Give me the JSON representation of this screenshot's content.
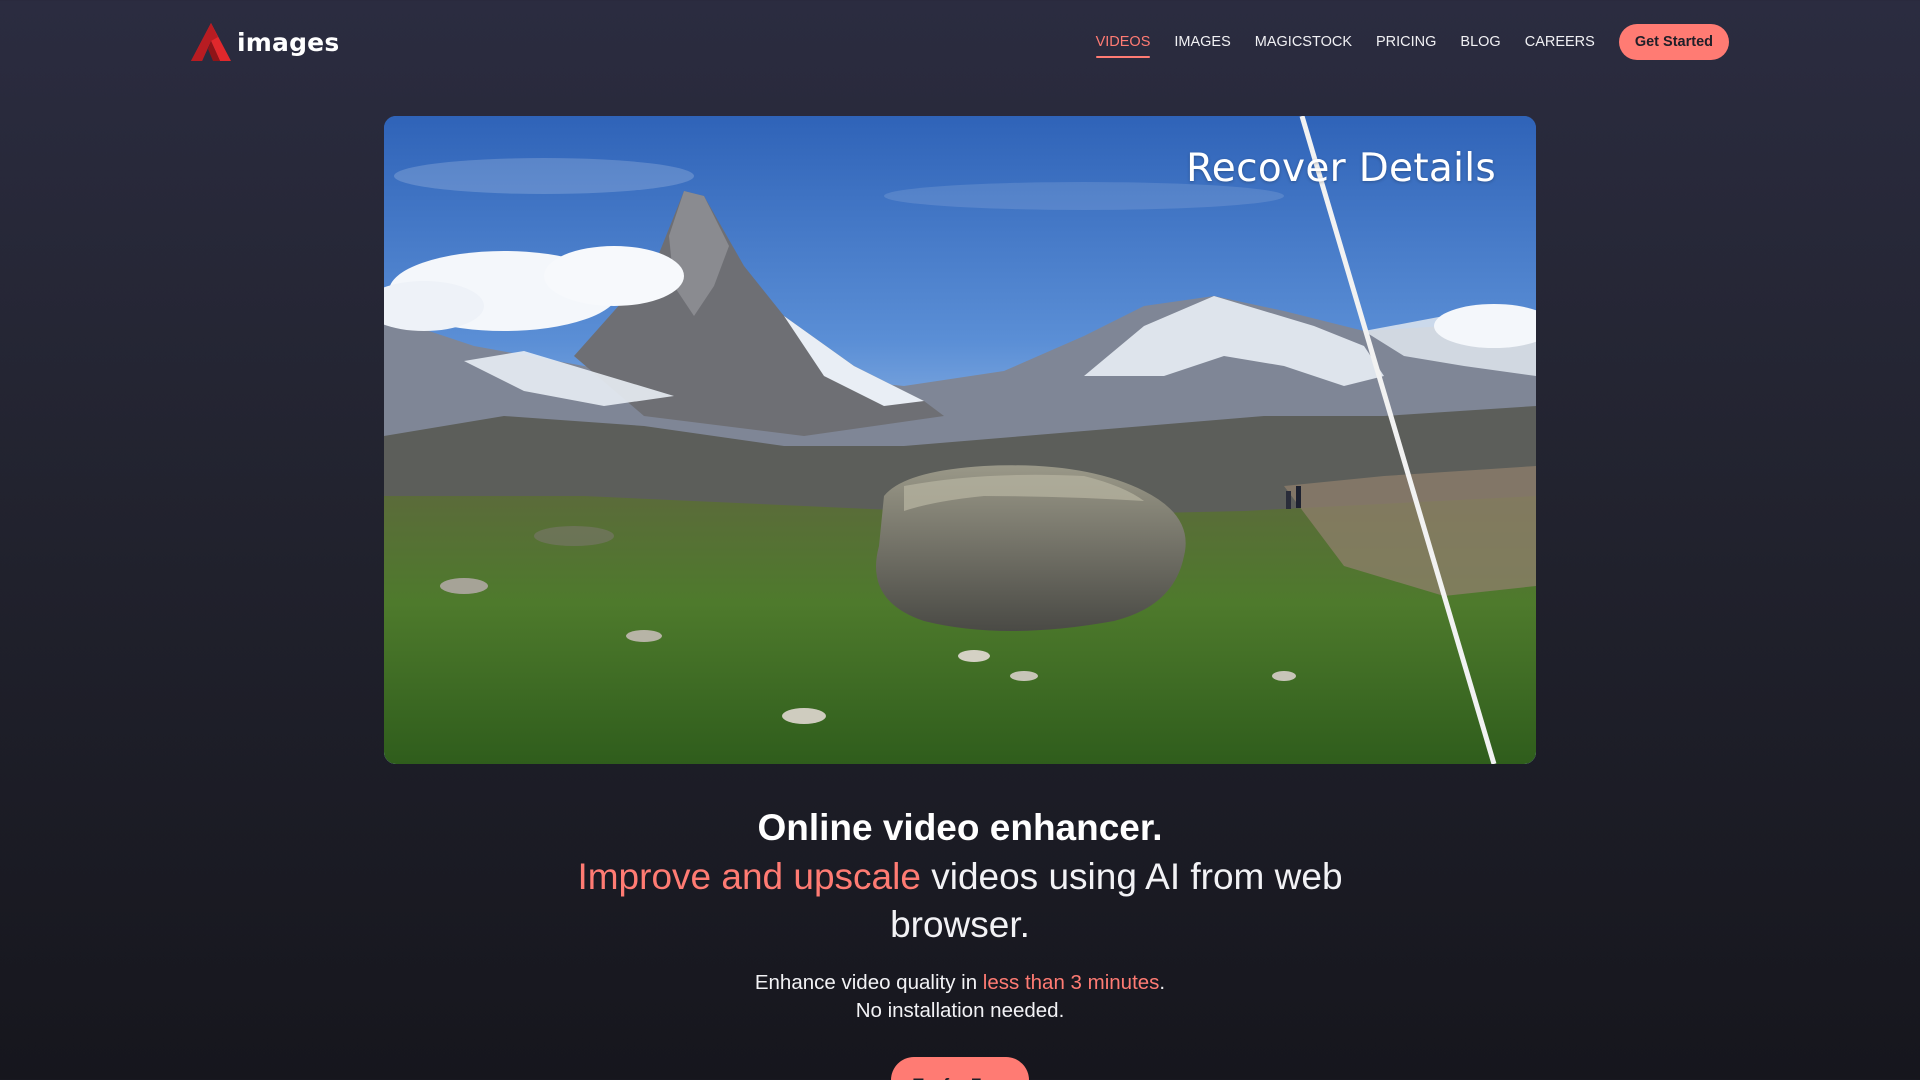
{
  "brand": {
    "name": "images",
    "accent_color": "#ff7b73",
    "logo_color": "#e0282c"
  },
  "nav": {
    "items": [
      {
        "label": "VIDEOS",
        "active": true
      },
      {
        "label": "IMAGES",
        "active": false
      },
      {
        "label": "MAGICSTOCK",
        "active": false
      },
      {
        "label": "PRICING",
        "active": false
      },
      {
        "label": "BLOG",
        "active": false
      },
      {
        "label": "CAREERS",
        "active": false
      }
    ],
    "cta_label": "Get Started"
  },
  "hero": {
    "overlay_text": "Recover Details"
  },
  "content": {
    "headline": "Online video enhancer.",
    "subline_accent": "Improve and upscale",
    "subline_rest": " videos using AI from web browser.",
    "desc_prefix": "Enhance video quality in ",
    "desc_accent": "less than 3 minutes",
    "desc_suffix": ".",
    "desc_line2": "No installation needed.",
    "cta_label": "Try for Free"
  }
}
